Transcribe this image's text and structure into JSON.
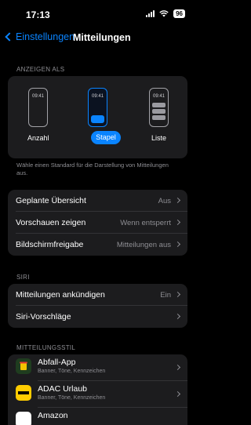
{
  "status": {
    "time": "17:13",
    "battery": "96"
  },
  "nav": {
    "back_label": "Einstellungen",
    "title": "Mitteilungen"
  },
  "display_as": {
    "header": "ANZEIGEN ALS",
    "options": [
      {
        "label": "Anzahl",
        "time": "09:41",
        "selected": false
      },
      {
        "label": "Stapel",
        "time": "09:41",
        "selected": true
      },
      {
        "label": "Liste",
        "time": "09:41",
        "selected": false
      }
    ],
    "note": "Wähle einen Standard für die Darstellung von Mitteilungen aus."
  },
  "general_rows": [
    {
      "label": "Geplante Übersicht",
      "value": "Aus"
    },
    {
      "label": "Vorschauen zeigen",
      "value": "Wenn entsperrt"
    },
    {
      "label": "Bildschirmfreigabe",
      "value": "Mitteilungen aus"
    }
  ],
  "siri": {
    "header": "SIRI",
    "rows": [
      {
        "label": "Mitteilungen ankündigen",
        "value": "Ein"
      },
      {
        "label": "Siri-Vorschläge",
        "value": ""
      }
    ]
  },
  "notification_style": {
    "header": "MITTEILUNGSSTIL",
    "apps": [
      {
        "name": "Abfall-App",
        "subtitle": "Banner, Töne, Kennzeichen",
        "icon": "abfall-app-icon",
        "color": "#1f3d1f"
      },
      {
        "name": "ADAC Urlaub",
        "subtitle": "Banner, Töne, Kennzeichen",
        "icon": "adac-icon",
        "color": "#ffcc00"
      },
      {
        "name": "Amazon",
        "subtitle": "",
        "icon": "amazon-icon",
        "color": "#ffffff"
      }
    ]
  },
  "colors": {
    "accent": "#0a84ff",
    "card": "#1c1c1e",
    "secondary_text": "#8e8e93"
  }
}
